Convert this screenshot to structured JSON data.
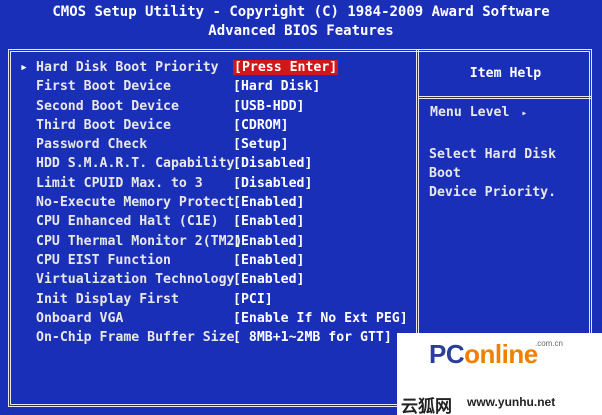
{
  "header": {
    "title": "CMOS Setup Utility - Copyright (C) 1984-2009 Award Software",
    "subtitle": "Advanced BIOS Features"
  },
  "menu": {
    "selected_arrow": "▸",
    "items": [
      {
        "label": "Hard Disk Boot Priority",
        "value": "[Press Enter]",
        "selected": true
      },
      {
        "label": "First Boot Device",
        "value": "[Hard Disk]"
      },
      {
        "label": "Second Boot Device",
        "value": "[USB-HDD]"
      },
      {
        "label": "Third Boot Device",
        "value": "[CDROM]"
      },
      {
        "label": "Password Check",
        "value": "[Setup]"
      },
      {
        "label": "HDD S.M.A.R.T. Capability",
        "value": "[Disabled]"
      },
      {
        "label": "Limit CPUID Max. to 3",
        "value": "[Disabled]"
      },
      {
        "label": "No-Execute Memory Protect",
        "value": "[Enabled]"
      },
      {
        "label": "CPU Enhanced Halt (C1E)",
        "value": "[Enabled]"
      },
      {
        "label": "CPU Thermal Monitor 2(TM2)",
        "value": "[Enabled]"
      },
      {
        "label": "CPU EIST Function",
        "value": "[Enabled]"
      },
      {
        "label": "Virtualization Technology",
        "value": "[Enabled]"
      },
      {
        "label": "Init Display First",
        "value": "[PCI]"
      },
      {
        "label": "Onboard VGA",
        "value": "[Enable If No Ext PEG]"
      },
      {
        "label": "On-Chip Frame Buffer Size",
        "value": "[ 8MB+1~2MB for GTT]"
      }
    ]
  },
  "help_panel": {
    "title": "Item Help",
    "menu_level_label": "Menu Level",
    "menu_level_indicator": "▸",
    "help_text": "Select Hard Disk Boot\nDevice Priority."
  },
  "watermark": {
    "logo_prefix": "PC",
    "logo_suffix": "online",
    "domain": ".com.cn",
    "cn_text": "云狐网",
    "url": "www.yunhu.net"
  },
  "colors": {
    "background": "#1a2fb8",
    "text": "#e8e8e8",
    "highlight": "#d01818"
  }
}
